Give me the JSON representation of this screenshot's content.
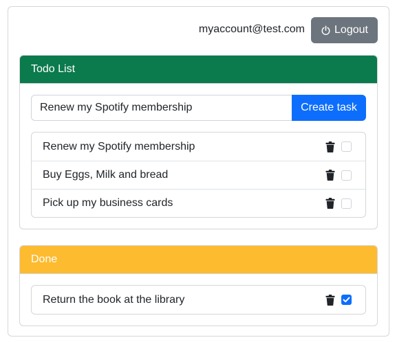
{
  "header": {
    "email": "myaccount@test.com",
    "logout_label": "Logout"
  },
  "todo": {
    "title": "Todo List",
    "header_color": "#0b7a4c",
    "input_value": "Renew my Spotify membership",
    "create_label": "Create task",
    "items": [
      {
        "text": "Renew my Spotify membership",
        "done": false
      },
      {
        "text": "Buy Eggs, Milk and bread",
        "done": false
      },
      {
        "text": "Pick up my business cards",
        "done": false
      }
    ]
  },
  "done": {
    "title": "Done",
    "header_color": "#fdbb30",
    "items": [
      {
        "text": "Return the book at the library",
        "done": true
      }
    ]
  },
  "icons": {
    "logout": "power-icon",
    "delete": "trash-icon",
    "checked": "checkmark-icon"
  }
}
